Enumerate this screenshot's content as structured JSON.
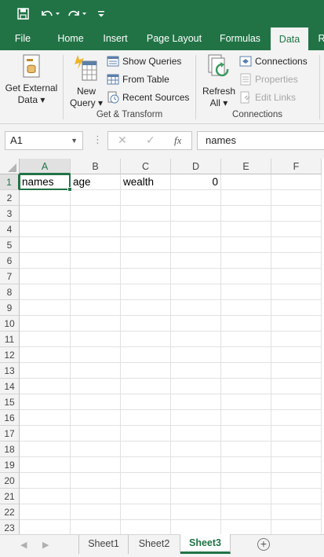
{
  "quick_access": {
    "save_icon": "save-icon",
    "undo_icon": "undo-icon",
    "redo_icon": "redo-icon",
    "customize_icon": "customize-qat-icon"
  },
  "tabs": [
    {
      "label": "File",
      "active": false
    },
    {
      "label": "Home",
      "active": false
    },
    {
      "label": "Insert",
      "active": false
    },
    {
      "label": "Page Layout",
      "active": false
    },
    {
      "label": "Formulas",
      "active": false
    },
    {
      "label": "Data",
      "active": true
    },
    {
      "label": "R",
      "active": false
    }
  ],
  "ribbon": {
    "get_external_data": {
      "line1": "Get External",
      "line2": "Data ▾"
    },
    "new_query": {
      "line1": "New",
      "line2": "Query ▾"
    },
    "show_queries": "Show Queries",
    "from_table": "From Table",
    "recent_sources": "Recent Sources",
    "get_transform_label": "Get & Transform",
    "refresh_all": {
      "line1": "Refresh",
      "line2": "All ▾"
    },
    "connections": "Connections",
    "properties": "Properties",
    "edit_links": "Edit Links",
    "connections_group_label": "Connections"
  },
  "formula_bar": {
    "name_box": "A1",
    "cancel_glyph": "✕",
    "enter_glyph": "✓",
    "fx_glyph": "fx",
    "formula": "names"
  },
  "grid": {
    "columns": [
      "A",
      "B",
      "C",
      "D",
      "E",
      "F"
    ],
    "selected_column": "A",
    "rows": [
      "1",
      "2",
      "3",
      "4",
      "5",
      "6",
      "7",
      "8",
      "9",
      "10",
      "11",
      "12",
      "13",
      "14",
      "15",
      "16",
      "17",
      "18",
      "19",
      "20",
      "21",
      "22",
      "23"
    ],
    "selected_row": "1",
    "cells": {
      "A1": "names",
      "B1": "age",
      "C1": "wealth",
      "D1": "0"
    }
  },
  "sheets": [
    {
      "label": "Sheet1",
      "active": false
    },
    {
      "label": "Sheet2",
      "active": false
    },
    {
      "label": "Sheet3",
      "active": true
    }
  ],
  "add_sheet_glyph": "+"
}
